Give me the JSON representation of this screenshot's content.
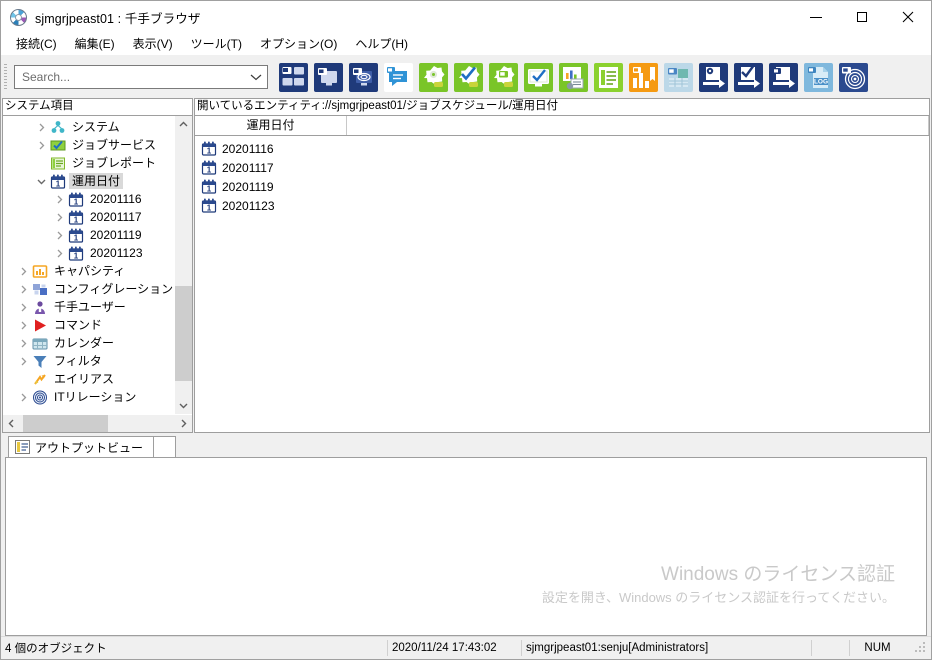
{
  "window": {
    "title": "sjmgrjpeast01 : 千手ブラウザ",
    "app_icon": "senju-logo-icon",
    "controls": {
      "minimize": "minimize-icon",
      "maximize": "maximize-icon",
      "close": "close-icon"
    }
  },
  "menubar": {
    "items": [
      {
        "label": "接続(C)",
        "name": "menu-connect"
      },
      {
        "label": "編集(E)",
        "name": "menu-edit"
      },
      {
        "label": "表示(V)",
        "name": "menu-view"
      },
      {
        "label": "ツール(T)",
        "name": "menu-tools"
      },
      {
        "label": "オプション(O)",
        "name": "menu-options"
      },
      {
        "label": "ヘルプ(H)",
        "name": "menu-help"
      }
    ]
  },
  "toolbar": {
    "search": {
      "value": "",
      "placeholder": "Search..."
    },
    "buttons": [
      {
        "name": "monitor-group-icon",
        "glyph": "multi-monitor",
        "bg": "#1f3a7a"
      },
      {
        "name": "monitor-single-icon",
        "glyph": "monitor",
        "bg": "#1f3a7a"
      },
      {
        "name": "monitor-network-icon",
        "glyph": "monitor-net",
        "bg": "#1f3a7a"
      },
      {
        "name": "message-icon",
        "glyph": "chat",
        "bg": "#ffffff"
      },
      {
        "name": "node-settings-icon",
        "glyph": "burst-gear",
        "bg": "#7ac528"
      },
      {
        "name": "node-check-icon",
        "glyph": "burst-check",
        "bg": "#7ac528"
      },
      {
        "name": "node-monitor-icon",
        "glyph": "burst-monitor",
        "bg": "#7ac528"
      },
      {
        "name": "screen-check-icon",
        "glyph": "screen-check",
        "bg": "#7ac528"
      },
      {
        "name": "report-chart-icon",
        "glyph": "chart-doc",
        "bg": "#7ac528"
      },
      {
        "name": "job-report-icon",
        "glyph": "list-doc",
        "bg": "#8bd12e"
      },
      {
        "name": "capacity-chart-icon",
        "glyph": "bar-flag",
        "bg": "#f59a12"
      },
      {
        "name": "calendar-grid-icon",
        "glyph": "grid-monitor",
        "bg": "#bcd8e8"
      },
      {
        "name": "export-settings-icon",
        "glyph": "page-arrow-gear",
        "bg": "#1f3a7a"
      },
      {
        "name": "export-check-icon",
        "glyph": "page-arrow-check",
        "bg": "#1f3a7a"
      },
      {
        "name": "export-monitor-icon",
        "glyph": "page-arrow-mon",
        "bg": "#1f3a7a"
      },
      {
        "name": "log-icon",
        "glyph": "log-page",
        "bg": "#7fb8dd"
      },
      {
        "name": "it-relation-icon",
        "glyph": "radar",
        "bg": "#2b4a8f"
      }
    ]
  },
  "sidebar": {
    "header": "システム項目",
    "items": [
      {
        "label": "システム",
        "icon": "system-icon",
        "depth": 1,
        "expandable": true,
        "expanded": false,
        "selected": false
      },
      {
        "label": "ジョブサービス",
        "icon": "job-service-icon",
        "depth": 1,
        "expandable": true,
        "expanded": false,
        "selected": false
      },
      {
        "label": "ジョブレポート",
        "icon": "job-report-icon",
        "depth": 1,
        "expandable": false,
        "expanded": false,
        "selected": false
      },
      {
        "label": "運用日付",
        "icon": "calendar-date-icon",
        "depth": 1,
        "expandable": true,
        "expanded": true,
        "selected": true
      },
      {
        "label": "20201116",
        "icon": "calendar-date-icon",
        "depth": 2,
        "expandable": true,
        "expanded": false,
        "selected": false
      },
      {
        "label": "20201117",
        "icon": "calendar-date-icon",
        "depth": 2,
        "expandable": true,
        "expanded": false,
        "selected": false
      },
      {
        "label": "20201119",
        "icon": "calendar-date-icon",
        "depth": 2,
        "expandable": true,
        "expanded": false,
        "selected": false
      },
      {
        "label": "20201123",
        "icon": "calendar-date-icon",
        "depth": 2,
        "expandable": true,
        "expanded": false,
        "selected": false
      },
      {
        "label": "キャパシティ",
        "icon": "capacity-icon",
        "depth": 0,
        "expandable": true,
        "expanded": false,
        "selected": false
      },
      {
        "label": "コンフィグレーション",
        "icon": "config-icon",
        "depth": 0,
        "expandable": true,
        "expanded": false,
        "selected": false
      },
      {
        "label": "千手ユーザー",
        "icon": "user-icon",
        "depth": 0,
        "expandable": true,
        "expanded": false,
        "selected": false
      },
      {
        "label": "コマンド",
        "icon": "command-icon",
        "depth": 0,
        "expandable": true,
        "expanded": false,
        "selected": false
      },
      {
        "label": "カレンダー",
        "icon": "calendar-icon",
        "depth": 0,
        "expandable": true,
        "expanded": false,
        "selected": false
      },
      {
        "label": "フィルタ",
        "icon": "filter-icon",
        "depth": 0,
        "expandable": true,
        "expanded": false,
        "selected": false
      },
      {
        "label": "エイリアス",
        "icon": "alias-icon",
        "depth": 0,
        "expandable": false,
        "expanded": false,
        "selected": false
      },
      {
        "label": "ITリレーション",
        "icon": "it-relation-icon",
        "depth": 0,
        "expandable": true,
        "expanded": false,
        "selected": false
      }
    ]
  },
  "content": {
    "entity_path": "開いているエンティティ://sjmgrjpeast01/ジョブスケジュール/運用日付",
    "columns": [
      "運用日付",
      ""
    ],
    "rows": [
      {
        "name": "20201116",
        "icon": "calendar-date-icon"
      },
      {
        "name": "20201117",
        "icon": "calendar-date-icon"
      },
      {
        "name": "20201119",
        "icon": "calendar-date-icon"
      },
      {
        "name": "20201123",
        "icon": "calendar-date-icon"
      }
    ]
  },
  "output": {
    "tab_label": "アウトプットビュー",
    "tab_icon": "output-view-icon",
    "text": ""
  },
  "watermark": {
    "title": "Windows のライセンス認証",
    "subtitle": "設定を開き、Windows のライセンス認証を行ってください。"
  },
  "statusbar": {
    "object_count": "4 個のオブジェクト",
    "timestamp": "2020/11/24 17:43:02",
    "connection": "sjmgrjpeast01:senju[Administrators]",
    "blank": "",
    "num_lock": "NUM"
  }
}
